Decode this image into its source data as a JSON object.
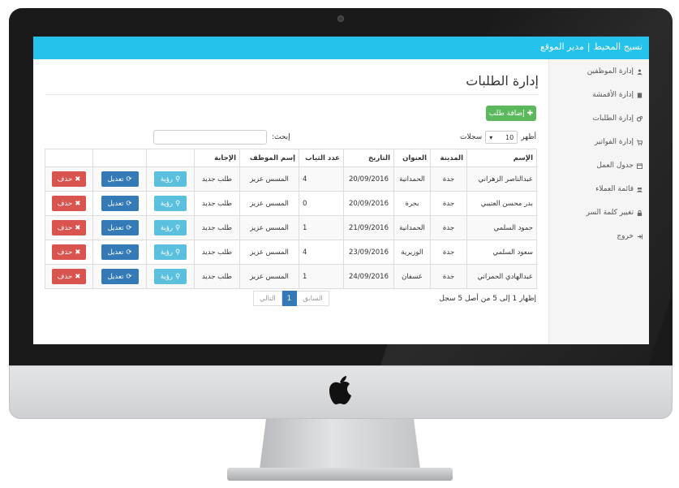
{
  "header": {
    "site_name": "نسيج المحيط",
    "separator": "|",
    "subtitle": "مدير الموقع"
  },
  "sidebar": {
    "items": [
      {
        "label": "إدارة الموظفين",
        "icon": "user-icon"
      },
      {
        "label": "إدارة الأقمشة",
        "icon": "book-icon"
      },
      {
        "label": "إدارة الطلبات",
        "icon": "cogs-icon"
      },
      {
        "label": "إدارة الفواتير",
        "icon": "cart-icon"
      },
      {
        "label": "جدول العمل",
        "icon": "calendar-icon"
      },
      {
        "label": "قائمة العملاء",
        "icon": "users-icon"
      },
      {
        "label": "تغيير كلمة السر",
        "icon": "lock-icon"
      },
      {
        "label": "خروج",
        "icon": "logout-icon"
      }
    ]
  },
  "main": {
    "title": "إدارة الطلبات",
    "add_button": "إضافة طلب",
    "show_label_before": "أظهر",
    "show_value": "10",
    "show_label_after": "سجلات",
    "search_label": "إبحث:",
    "search_value": ""
  },
  "table": {
    "headers": [
      "الإسم",
      "المدينة",
      "العنوان",
      "التاريخ",
      "عدد الثياب",
      "إسم الموظف",
      "الإجابة",
      "",
      "",
      ""
    ],
    "rows": [
      {
        "name": "عبدالناصر الزهراني",
        "city": "جدة",
        "address": "الحمدانية",
        "date": "20/09/2016",
        "count": "4",
        "employee": "المسس عزيز",
        "status": "طلب جديد"
      },
      {
        "name": "بدر محسن العتيبي",
        "city": "جدة",
        "address": "بحرة",
        "date": "20/09/2016",
        "count": "0",
        "employee": "المسس عزيز",
        "status": "طلب جديد"
      },
      {
        "name": "حمود السلمي",
        "city": "جدة",
        "address": "الحمدانية",
        "date": "21/09/2016",
        "count": "1",
        "employee": "المسس عزيز",
        "status": "طلب جديد"
      },
      {
        "name": "سعود السلمي",
        "city": "جدة",
        "address": "الوزيرية",
        "date": "23/09/2016",
        "count": "4",
        "employee": "المسس عزيز",
        "status": "طلب جديد"
      },
      {
        "name": "عبدالهادي الحمراني",
        "city": "جدة",
        "address": "عسفان",
        "date": "24/09/2016",
        "count": "1",
        "employee": "المسس عزيز",
        "status": "طلب جديد"
      }
    ],
    "actions": {
      "view": "رؤية",
      "edit": "تعديل",
      "delete": "حذف"
    }
  },
  "footer": {
    "info": "إظهار 1 إلى 5 من أصل 5 سجل",
    "prev": "السابق",
    "page": "1",
    "next": "التالي"
  },
  "colors": {
    "topbar": "#25c2ec",
    "add": "#5cb85c",
    "view": "#5bc0de",
    "edit": "#337ab7",
    "delete": "#d9534f"
  }
}
